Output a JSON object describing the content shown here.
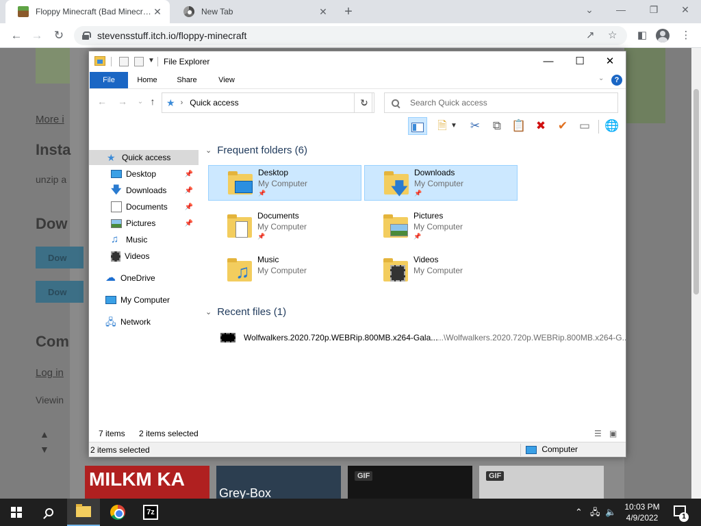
{
  "browser": {
    "tabs": [
      {
        "title": "Floppy Minecraft (Bad Minecraft",
        "close": "✕"
      },
      {
        "title": "New Tab",
        "close": "✕"
      }
    ],
    "new_tab": "+",
    "url": "stevensstuff.itch.io/floppy-minecraft"
  },
  "webpage": {
    "more_link": "More i",
    "install_heading": "Insta",
    "unzip_text": "unzip a",
    "download_heading": "Dow",
    "button_text": "Dow",
    "comments_heading": "Com",
    "login_link": "Log in",
    "viewing_text": "Viewin",
    "thumbnails": [
      {
        "label": "MILKM KA"
      },
      {
        "label": "Grey-Box"
      },
      {
        "label": "GIF"
      },
      {
        "label": "GIF"
      }
    ]
  },
  "explorer": {
    "title": "File Explorer",
    "ribbon_tabs": [
      "File",
      "Home",
      "Share",
      "View"
    ],
    "help": "?",
    "address": "Quick access",
    "search_placeholder": "Search Quick access",
    "nav": [
      {
        "label": "Quick access",
        "pinned": false
      },
      {
        "label": "Desktop",
        "pinned": true
      },
      {
        "label": "Downloads",
        "pinned": true
      },
      {
        "label": "Documents",
        "pinned": true
      },
      {
        "label": "Pictures",
        "pinned": true
      },
      {
        "label": "Music",
        "pinned": false
      },
      {
        "label": "Videos",
        "pinned": false
      },
      {
        "label": "OneDrive",
        "pinned": false
      },
      {
        "label": "My Computer",
        "pinned": false
      },
      {
        "label": "Network",
        "pinned": false
      }
    ],
    "frequent_header": "Frequent folders (6)",
    "folders": [
      {
        "name": "Desktop",
        "location": "My Computer",
        "pinned": true,
        "selected": true
      },
      {
        "name": "Downloads",
        "location": "My Computer",
        "pinned": true,
        "selected": true
      },
      {
        "name": "Documents",
        "location": "My Computer",
        "pinned": true,
        "selected": false
      },
      {
        "name": "Pictures",
        "location": "My Computer",
        "pinned": true,
        "selected": false
      },
      {
        "name": "Music",
        "location": "My Computer",
        "pinned": false,
        "selected": false
      },
      {
        "name": "Videos",
        "location": "My Computer",
        "pinned": false,
        "selected": false
      }
    ],
    "recent_header": "Recent files (1)",
    "recent_files": [
      {
        "name": "Wolfwalkers.2020.720p.WEBRip.800MB.x264-Gala...",
        "path": "...\\Wolfwalkers.2020.720p.WEBRip.800MB.x264-G..."
      }
    ],
    "status_items": "7 items",
    "status_selected": "2 items selected",
    "bottom_selected": "2 items selected",
    "bottom_location": "Computer"
  },
  "taskbar": {
    "time": "10:03 PM",
    "date": "4/9/2022",
    "notifications": "1",
    "sevenzip": "7z"
  }
}
